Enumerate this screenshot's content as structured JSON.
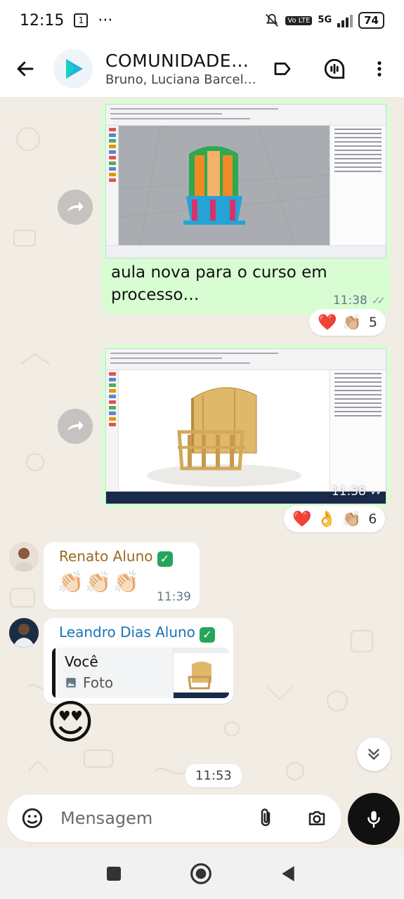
{
  "status_bar": {
    "time": "12:15",
    "dots": "···",
    "network": "5G",
    "volte": "Vo LTE",
    "battery": "74"
  },
  "header": {
    "title": "COMUNIDADE…",
    "members": "Bruno, Luciana Barcel…",
    "avatar_icon": "play-logo-icon",
    "accent": "#1fb6d9"
  },
  "messages": [
    {
      "type": "image",
      "direction": "outgoing",
      "caption": "aula nova para o curso em processo…",
      "time": "11:38",
      "status": "read",
      "reactions": {
        "emojis": [
          "❤️",
          "👏🏼"
        ],
        "count": "5"
      }
    },
    {
      "type": "image",
      "direction": "outgoing",
      "time": "11:38",
      "status": "read",
      "reactions": {
        "emojis": [
          "❤️",
          "👌",
          "👏🏼"
        ],
        "count": "6"
      }
    },
    {
      "type": "text",
      "direction": "incoming",
      "sender": "Renato Aluno",
      "sender_color": "#9c6a1e",
      "verified": "✓",
      "text": "👏🏻👏🏻👏🏻",
      "time": "11:39"
    },
    {
      "type": "reply",
      "direction": "incoming",
      "sender": "Leandro Dias Aluno",
      "sender_color": "#1a73b8",
      "verified": "✓",
      "quote_author": "Você",
      "quote_text": "Foto"
    },
    {
      "type": "sticker",
      "direction": "incoming",
      "emoji": "😍",
      "time": "11:53"
    }
  ],
  "composer": {
    "placeholder": "Mensagem"
  },
  "colors": {
    "outgoing_bubble": "#d9fdd3",
    "chat_background": "#f1ece4",
    "read_ticks": "#8a9aa5"
  }
}
